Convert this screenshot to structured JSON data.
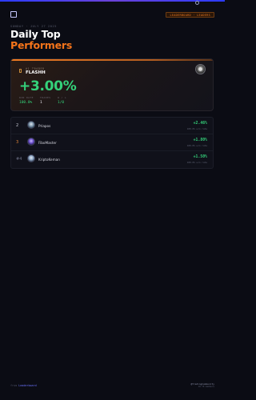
{
  "header": {
    "badge": "Leaderboard · Leaders",
    "date_line": "SUNDAY · JULY 27 2025",
    "title_line1": "Daily Top",
    "title_line2": "Performers"
  },
  "hero": {
    "label": "#1 TRADER",
    "name": "FLASHH",
    "value": "+3.00%",
    "stats": [
      {
        "label": "WIN RATE",
        "value": "100.0%"
      },
      {
        "label": "TRADES",
        "value": "1"
      },
      {
        "label": "W / L",
        "value": "1/0"
      }
    ]
  },
  "list": {
    "rows": [
      {
        "rank": "2",
        "name": "Priapos",
        "pct": "+2.46%",
        "sub": "100.0% win rate",
        "rank_color": "#c9cbd6"
      },
      {
        "rank": "3",
        "name": "FiboMaster",
        "pct": "+1.80%",
        "sub": "100.0% win rate",
        "rank_color": "#e0843a"
      },
      {
        "rank": "#4",
        "name": "KriptoKeman",
        "pct": "+1.50%",
        "sub": "100.0% win rate",
        "rank_color": "#6a6e84"
      }
    ]
  },
  "footer": {
    "left_a": "from",
    "left_b": "Leaderboard",
    "right_line1": "@TradingCommunity",
    "right_line2": "10.7K members"
  },
  "colors": {
    "accent_orange": "#f5741a",
    "gain_green": "#34d17a",
    "background": "#0b0c14"
  }
}
